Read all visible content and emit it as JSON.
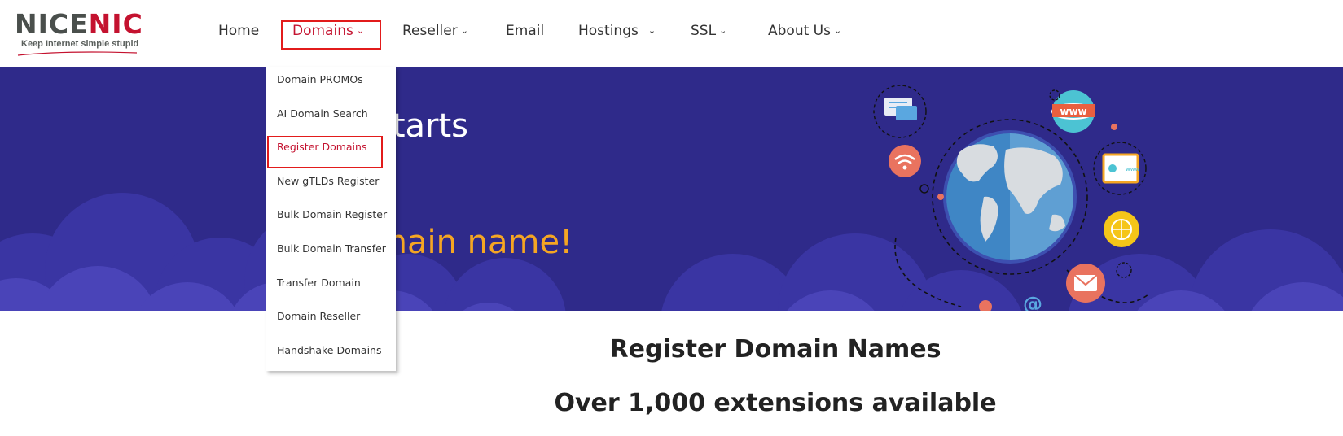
{
  "logo": {
    "word_part1": "NICE",
    "word_part2": "NIC",
    "tagline": "Keep Internet simple stupid"
  },
  "nav": {
    "items": [
      {
        "label": "Home",
        "has_chevron": false
      },
      {
        "label": "Domains",
        "has_chevron": true,
        "active": true
      },
      {
        "label": "Reseller",
        "has_chevron": true
      },
      {
        "label": "Email",
        "has_chevron": false
      },
      {
        "label": "Hostings",
        "has_chevron": true
      },
      {
        "label": "SSL",
        "has_chevron": true
      },
      {
        "label": "About Us",
        "has_chevron": true
      }
    ],
    "chevron": "⌄"
  },
  "dropdown": {
    "items": [
      "Domain PROMOs",
      "AI Domain Search",
      "Register Domains",
      "New gTLDs Register",
      "Bulk Domain Register",
      "Bulk Domain Transfer",
      "Transfer Domain",
      "Domain Reseller",
      "Handshake Domains"
    ],
    "active_index": 2
  },
  "banner": {
    "line1_visible": "starts",
    "line2_visible": "main name!",
    "icons": [
      "chat-icon",
      "www-icon",
      "wifi-icon",
      "browser-icon",
      "globe-icon",
      "mail-icon",
      "at-icon"
    ]
  },
  "content": {
    "title": "Register Domain Names",
    "subtitle": "Over 1,000 extensions available"
  },
  "colors": {
    "brand_red": "#c4122f",
    "banner_bg": "#2f2a8a",
    "banner_accent": "#f5a623",
    "highlight_box": "#e21b1b"
  }
}
